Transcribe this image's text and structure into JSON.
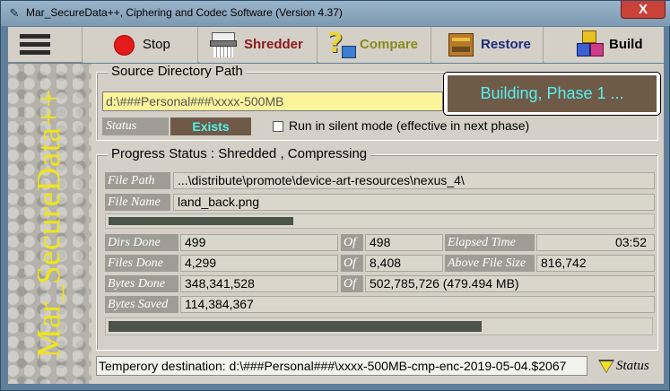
{
  "window": {
    "title": "Mar_SecureData++, Ciphering and Codec Software (Version 4.37)",
    "close_glyph": "X",
    "app_icon": "app-icon"
  },
  "toolbar": {
    "menu_icon": "hamburger-menu-icon",
    "stop": "Stop",
    "shredder": "Shredder",
    "compare": "Compare",
    "restore": "Restore",
    "build": "Build",
    "colors": {
      "shredder": "#8b1a1a",
      "compare": "#8a8a1a",
      "restore": "#1a2a7a"
    }
  },
  "sidebar": {
    "brand": "Mar_SecureData++",
    "brand_color": "#f0e41c"
  },
  "source": {
    "title": "Source Directory Path",
    "path": "d:\\###Personal###\\xxxx-500MB",
    "status_label": "Status",
    "status_value": "Exists",
    "silent_mode_label": "Run in silent mode (effective in next phase)",
    "silent_mode_checked": false,
    "phase": "Building, Phase 1 ..."
  },
  "progress": {
    "title": "Progress Status :  Shredded ,  Compressing",
    "file_path_label": "File Path",
    "file_path": "...\\distribute\\promote\\device-art-resources\\nexus_4\\",
    "file_name_label": "File Name",
    "file_name": "land_back.png",
    "file_bar_fraction": 0.34,
    "dirs_done_label": "Dirs Done",
    "dirs_done": "499",
    "dirs_of_label": "Of",
    "dirs_total": "498",
    "elapsed_label": "Elapsed Time",
    "elapsed": "03:52",
    "files_done_label": "Files Done",
    "files_done": "4,299",
    "files_of_label": "Of",
    "files_total": "8,408",
    "above_size_label": "Above File Size",
    "above_size": "816,742",
    "bytes_done_label": "Bytes Done",
    "bytes_done": "348,341,528",
    "bytes_of_label": "Of",
    "bytes_total": "502,785,726 (479.494 MB)",
    "bytes_saved_label": "Bytes Saved",
    "bytes_saved": "114,384,367",
    "overall_bar_fraction": 0.69
  },
  "footer": {
    "temp_destination": "Temperory destination: d:\\###Personal###\\xxxx-500MB-cmp-enc-2019-05-04.$2067",
    "status_toggle": "Status",
    "toggle_icon": "triangle-down-icon"
  }
}
